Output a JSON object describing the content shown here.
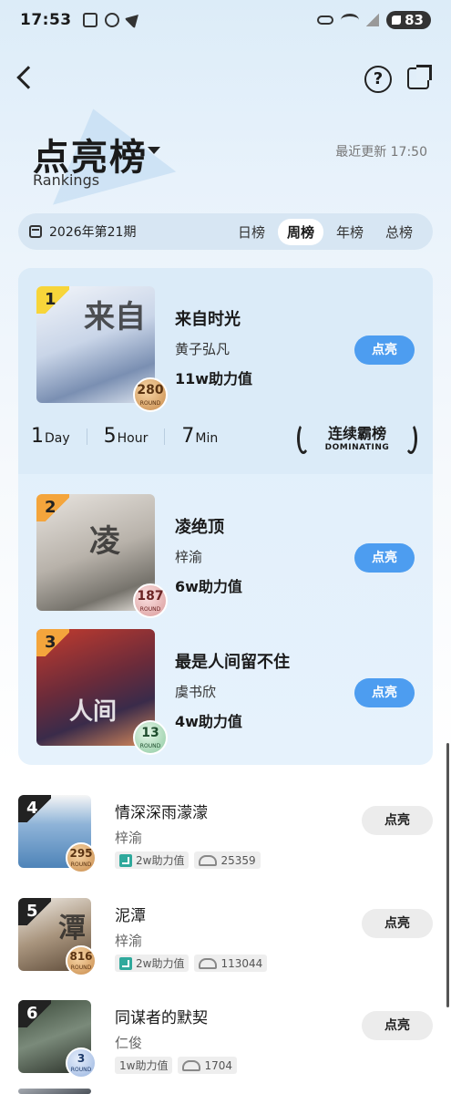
{
  "status_bar": {
    "time": "17:53",
    "battery": "83"
  },
  "header": {
    "title": "点亮榜",
    "subtitle": "Rankings",
    "update_time": "最近更新 17:50"
  },
  "period": {
    "label": "2026年第21期",
    "tabs": [
      "日榜",
      "周榜",
      "年榜",
      "总榜"
    ],
    "active_tab": "周榜"
  },
  "top_songs": [
    {
      "rank": "1",
      "title": "来自时光",
      "artist": "黄子弘凡",
      "points": "11w助力值",
      "badge": "280",
      "button": "点亮"
    },
    {
      "rank": "2",
      "title": "凌绝顶",
      "artist": "梓渝",
      "points": "6w助力值",
      "badge": "187",
      "button": "点亮"
    },
    {
      "rank": "3",
      "title": "最是人间留不住",
      "artist": "虞书欣",
      "points": "4w助力值",
      "badge": "13",
      "button": "点亮"
    }
  ],
  "countdown": {
    "day": "1",
    "day_unit": "Day",
    "hour": "5",
    "hour_unit": "Hour",
    "min": "7",
    "min_unit": "Min"
  },
  "dominating": {
    "cn": "连续霸榜",
    "en": "DOMINATING"
  },
  "badge_round": "ROUND",
  "list": [
    {
      "rank": "4",
      "title": "情深深雨濛濛",
      "artist": "梓渝",
      "points": "2w助力值",
      "fans": "25359",
      "badge": "295",
      "button": "点亮",
      "trend": true
    },
    {
      "rank": "5",
      "title": "泥潭",
      "artist": "梓渝",
      "points": "2w助力值",
      "fans": "113044",
      "badge": "816",
      "button": "点亮",
      "trend": true
    },
    {
      "rank": "6",
      "title": "同谋者的默契",
      "artist": "仁俊",
      "points": "1w助力值",
      "fans": "1704",
      "badge": "3",
      "button": "点亮",
      "trend": false
    }
  ],
  "colors": {
    "accent": "#4d9df0",
    "gold": "#f7d53a",
    "orange": "#f4a53c"
  }
}
